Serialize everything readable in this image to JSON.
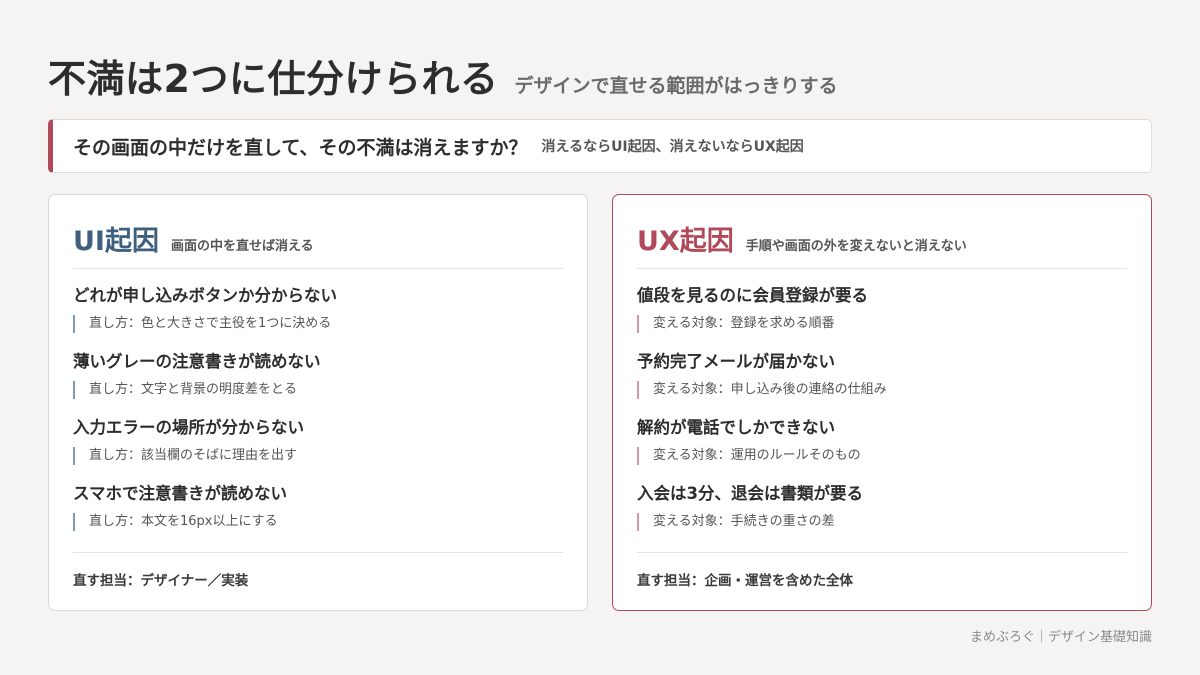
{
  "header": {
    "title": "不満は2つに仕分けられる",
    "subtitle": "デザインで直せる範囲がはっきりする"
  },
  "question": {
    "main": "その画面の中だけを直して、その不満は消えますか？",
    "sub": "消えるならUI起因、消えないならUX起因"
  },
  "ui_card": {
    "title": "UI起因",
    "desc": "画面の中を直せば消える",
    "items": [
      {
        "title": "どれが申し込みボタンか分からない",
        "fix": "直し方：色と大きさで主役を1つに決める"
      },
      {
        "title": "薄いグレーの注意書きが読めない",
        "fix": "直し方：文字と背景の明度差をとる"
      },
      {
        "title": "入力エラーの場所が分からない",
        "fix": "直し方：該当欄のそばに理由を出す"
      },
      {
        "title": "スマホで注意書きが読めない",
        "fix": "直し方：本文を16px以上にする"
      }
    ],
    "footer": "直す担当：デザイナー／実装"
  },
  "ux_card": {
    "title": "UX起因",
    "desc": "手順や画面の外を変えないと消えない",
    "items": [
      {
        "title": "値段を見るのに会員登録が要る",
        "fix": "変える対象：登録を求める順番"
      },
      {
        "title": "予約完了メールが届かない",
        "fix": "変える対象：申し込み後の連絡の仕組み"
      },
      {
        "title": "解約が電話でしかできない",
        "fix": "変える対象：運用のルールそのもの"
      },
      {
        "title": "入会は3分、退会は書類が要る",
        "fix": "変える対象：手続きの重さの差"
      }
    ],
    "footer": "直す担当：企画・運営を含めた全体"
  },
  "credit": "まめぶろぐ｜デザイン基礎知識",
  "colors": {
    "ui_accent": "#3e5f7e",
    "ux_accent": "#b04a5a"
  }
}
